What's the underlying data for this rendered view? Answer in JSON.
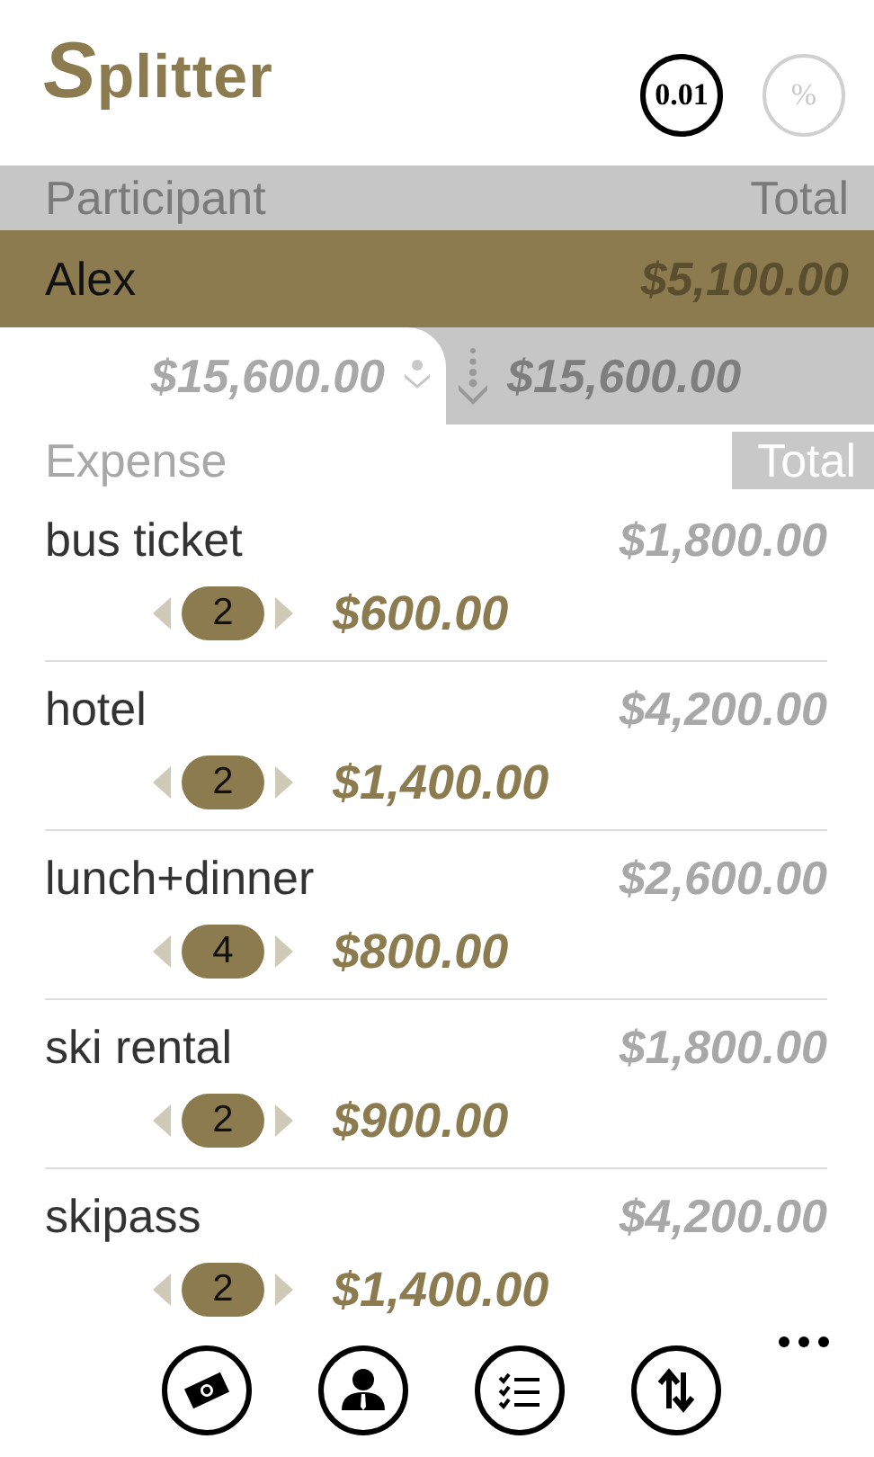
{
  "app": {
    "logo": "Splitter"
  },
  "toggles": [
    {
      "label": "0.01",
      "selected": true
    },
    {
      "label": "%",
      "selected": false
    }
  ],
  "participants": {
    "columns": [
      "Participant",
      "Total"
    ],
    "rows": [
      {
        "name": "Alex",
        "total": "$5,100.00",
        "selected": true
      }
    ]
  },
  "total_tabs": [
    {
      "amount": "$15,600.00",
      "kind": "person",
      "selected": true
    },
    {
      "amount": "$15,600.00",
      "kind": "all",
      "selected": false
    }
  ],
  "expenses": {
    "columns": [
      "Expense",
      "Total"
    ],
    "rows": [
      {
        "name": "bus ticket",
        "total": "$1,800.00",
        "count": "2",
        "share": "$600.00"
      },
      {
        "name": "hotel",
        "total": "$4,200.00",
        "count": "2",
        "share": "$1,400.00"
      },
      {
        "name": "lunch+dinner",
        "total": "$2,600.00",
        "count": "4",
        "share": "$800.00"
      },
      {
        "name": "ski rental",
        "total": "$1,800.00",
        "count": "2",
        "share": "$900.00"
      },
      {
        "name": "skipass",
        "total": "$4,200.00",
        "count": "2",
        "share": "$1,400.00"
      }
    ]
  },
  "app_bar": [
    {
      "kind": "money"
    },
    {
      "kind": "person"
    },
    {
      "kind": "checklist"
    },
    {
      "kind": "sort"
    },
    {
      "kind": "more"
    }
  ]
}
